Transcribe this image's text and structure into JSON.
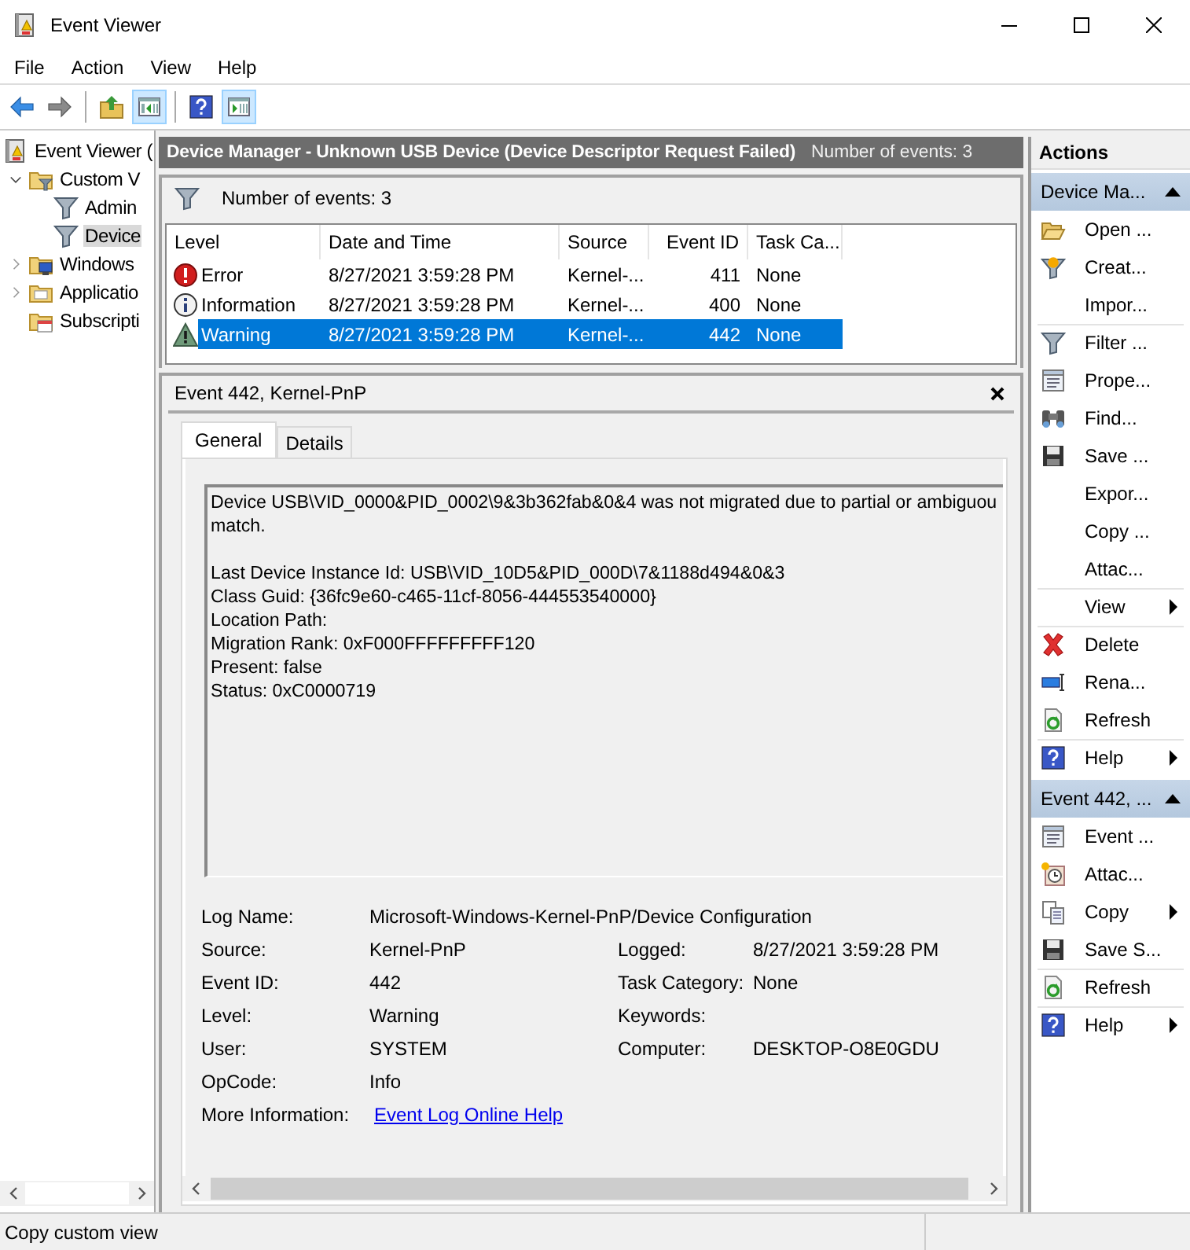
{
  "window": {
    "title": "Event Viewer"
  },
  "menu": [
    "File",
    "Action",
    "View",
    "Help"
  ],
  "toolbar": [
    [
      {
        "kind": "back",
        "on": false
      },
      {
        "kind": "forward",
        "on": false
      }
    ],
    [
      {
        "kind": "up",
        "on": false
      },
      {
        "kind": "tree-pane",
        "on": true
      }
    ],
    [
      {
        "kind": "help",
        "on": false
      },
      {
        "kind": "action-pane",
        "on": true
      }
    ]
  ],
  "tree": [
    {
      "label": "Event Viewer (",
      "selected": false,
      "children": [
        {
          "label": "Custom V",
          "expanded": true,
          "selected": false,
          "children": [
            {
              "label": "Admin",
              "selected": false
            },
            {
              "label": "Device",
              "selected": true
            }
          ]
        },
        {
          "label": "Windows",
          "expanded": false,
          "selected": false
        },
        {
          "label": "Applicatio",
          "expanded": false,
          "selected": false
        },
        {
          "label": "Subscripti",
          "selected": false
        }
      ]
    }
  ],
  "center": {
    "title": "Device Manager - Unknown USB Device (Device Descriptor Request Failed)",
    "count": "Number of events: 3",
    "filter_text": "Number of events: 3",
    "columns": [
      "Level",
      "Date and Time",
      "Source",
      "Event ID",
      "Task Ca..."
    ],
    "rows": [
      {
        "kind": "error",
        "selected": false,
        "cells": [
          "Error",
          "8/27/2021 3:59:28 PM",
          "Kernel-...",
          "411",
          "None"
        ]
      },
      {
        "kind": "information",
        "selected": false,
        "cells": [
          "Information",
          "8/27/2021 3:59:28 PM",
          "Kernel-...",
          "400",
          "None"
        ]
      },
      {
        "kind": "warning",
        "selected": true,
        "cells": [
          "Warning",
          "8/27/2021 3:59:28 PM",
          "Kernel-...",
          "442",
          "None"
        ]
      }
    ]
  },
  "detail": {
    "title": "Event 442, Kernel-PnP",
    "tabs": [
      {
        "label": "General",
        "selected": true
      },
      {
        "label": "Details",
        "selected": false
      }
    ],
    "message": [
      [
        "Device USB\\VID_0000&PID_0002\\9&3b362fab&0&4 was not migrated due to partial or ambiguou",
        "match."
      ],
      [
        "Last Device Instance Id: USB\\VID_10D5&PID_000D\\7&1188d494&0&3",
        "Class Guid: {36fc9e60-c465-11cf-8056-444553540000}",
        "Location Path:",
        "Migration Rank: 0xF000FFFFFFFFF120",
        "Present: false",
        "Status: 0xC0000719"
      ]
    ],
    "fields": [
      {
        "label": "Log Name:",
        "value": "Microsoft-Windows-Kernel-PnP/Device Configuration"
      },
      {
        "label": "Source:",
        "value": "Kernel-PnP",
        "label2": "Logged:",
        "value2": "8/27/2021 3:59:28 PM"
      },
      {
        "label": "Event ID:",
        "value": "442",
        "label2": "Task Category:",
        "value2": "None"
      },
      {
        "label": "Level:",
        "value": "Warning",
        "label2": "Keywords:"
      },
      {
        "label": "User:",
        "value": "SYSTEM",
        "label2": "Computer:",
        "value2": "DESKTOP-O8E0GDU"
      },
      {
        "label": "OpCode:",
        "value": "Info"
      }
    ],
    "more_info": {
      "label": "More Information:",
      "link": "Event Log Online Help"
    }
  },
  "actions": {
    "title": "Actions",
    "sections": [
      {
        "title": "Device Ma...",
        "expanded": true,
        "items": [
          {
            "label": "Open ...",
            "submenu": false,
            "divider_before": false
          },
          {
            "label": "Creat...",
            "submenu": false,
            "divider_before": false
          },
          {
            "label": "Impor...",
            "submenu": false,
            "divider_before": false
          },
          {
            "label": "Filter ...",
            "submenu": false,
            "divider_before": true
          },
          {
            "label": "Prope...",
            "submenu": false,
            "divider_before": false
          },
          {
            "label": "Find...",
            "submenu": false,
            "divider_before": false
          },
          {
            "label": "Save ...",
            "submenu": false,
            "divider_before": false
          },
          {
            "label": "Expor...",
            "submenu": false,
            "divider_before": false
          },
          {
            "label": "Copy ...",
            "submenu": false,
            "divider_before": false
          },
          {
            "label": "Attac...",
            "submenu": false,
            "divider_before": false
          },
          {
            "label": "View",
            "submenu": true,
            "divider_before": true
          },
          {
            "label": "Delete",
            "submenu": false,
            "divider_before": true
          },
          {
            "label": "Rena...",
            "submenu": false,
            "divider_before": false
          },
          {
            "label": "Refresh",
            "submenu": false,
            "divider_before": false
          },
          {
            "label": "Help",
            "submenu": true,
            "divider_before": true
          }
        ]
      },
      {
        "title": "Event 442, ...",
        "expanded": true,
        "items": [
          {
            "label": "Event ...",
            "submenu": false,
            "divider_before": false
          },
          {
            "label": "Attac...",
            "submenu": false,
            "divider_before": false
          },
          {
            "label": "Copy",
            "submenu": true,
            "divider_before": false
          },
          {
            "label": "Save S...",
            "submenu": false,
            "divider_before": false
          },
          {
            "label": "Refresh",
            "submenu": false,
            "divider_before": true
          },
          {
            "label": "Help",
            "submenu": true,
            "divider_before": true
          }
        ]
      }
    ]
  },
  "status_bar": {
    "text": "Copy custom view"
  }
}
